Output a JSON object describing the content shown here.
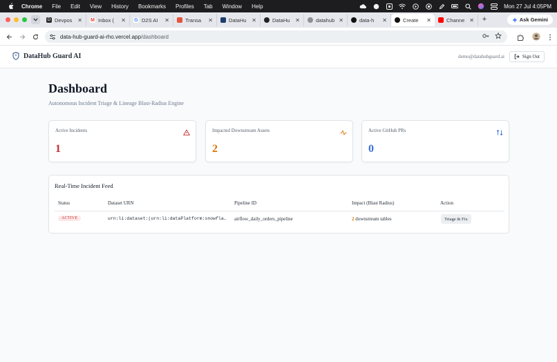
{
  "menubar": {
    "app": "Chrome",
    "items": [
      "File",
      "Edit",
      "View",
      "History",
      "Bookmarks",
      "Profiles",
      "Tab",
      "Window",
      "Help"
    ],
    "datetime": "Mon 27 Jul  4:05PM"
  },
  "tabs": [
    {
      "label": "Devpos",
      "icon": "devpost-icon",
      "color": "#2d2d2d"
    },
    {
      "label": "Inbox (",
      "icon": "gmail-icon",
      "color": "#ea4335"
    },
    {
      "label": "D2S AI",
      "icon": "google-icon",
      "color": "#4285f4"
    },
    {
      "label": "Transa",
      "icon": "app-icon",
      "color": "#e5533c"
    },
    {
      "label": "DataHu",
      "icon": "datahub-icon",
      "color": "#1f3d6b"
    },
    {
      "label": "DataHu",
      "icon": "github-icon",
      "color": "#222222"
    },
    {
      "label": "datahub",
      "icon": "globe-icon",
      "color": "#666666"
    },
    {
      "label": "data-h",
      "icon": "vercel-icon",
      "color": "#111111"
    },
    {
      "label": "Create",
      "icon": "vercel-icon",
      "color": "#111111",
      "active": true
    },
    {
      "label": "Channe",
      "icon": "youtube-icon",
      "color": "#ff0000"
    }
  ],
  "gemini_label": "Ask Gemini",
  "address": {
    "host": "data-hub-guard-ai-rho.vercel.app",
    "path": "/dashboard"
  },
  "header": {
    "brand": "DataHub Guard AI",
    "user_email": "demo@datahubguard.ai",
    "sign_out": "Sign Out"
  },
  "page": {
    "title": "Dashboard",
    "subtitle": "Autonomous Incident Triage & Lineage Blast-Radius Engine"
  },
  "stats": [
    {
      "label": "Active Incidents",
      "value": "1",
      "icon": "alert-triangle-icon",
      "color": "#c53030"
    },
    {
      "label": "Impacted Downstream Assets",
      "value": "2",
      "icon": "activity-icon",
      "color": "#d97706"
    },
    {
      "label": "Active GitHub PRs",
      "value": "0",
      "icon": "pull-request-icon",
      "color": "#3b6fd6"
    }
  ],
  "feed": {
    "title": "Real-Time Incident Feed",
    "columns": [
      "Status",
      "Dataset URN",
      "Pipeline ID",
      "Impact (Blast Radius)",
      "Action"
    ],
    "rows": [
      {
        "status": "ACTIVE",
        "urn": "urn:li:dataset:(urn:li:dataPlatform:snowfla…",
        "pipeline": "airflow_daily_orders_pipeline",
        "impact_count": "2",
        "impact_text": " downstream tables",
        "action": "Triage & Fix"
      }
    ]
  }
}
